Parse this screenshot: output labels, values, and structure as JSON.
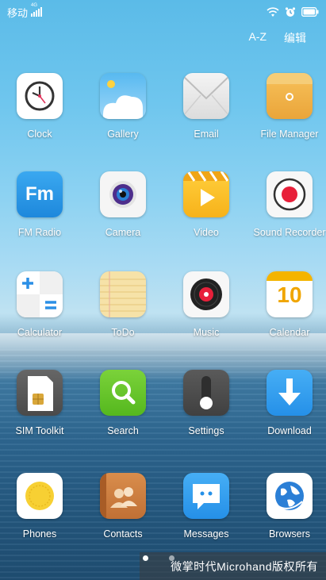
{
  "status_bar": {
    "carrier": "移动",
    "network_tag": "4G"
  },
  "top_actions": {
    "sort": "A-Z",
    "edit": "编辑"
  },
  "apps": [
    {
      "label": "Clock",
      "icon": "clock-icon"
    },
    {
      "label": "Gallery",
      "icon": "gallery-icon"
    },
    {
      "label": "Email",
      "icon": "email-icon"
    },
    {
      "label": "File Manager",
      "icon": "file-manager-icon"
    },
    {
      "label": "FM Radio",
      "icon": "fm-radio-icon",
      "icon_text": "Fm"
    },
    {
      "label": "Camera",
      "icon": "camera-icon"
    },
    {
      "label": "Video",
      "icon": "video-icon"
    },
    {
      "label": "Sound Recorder",
      "icon": "sound-recorder-icon"
    },
    {
      "label": "Calculator",
      "icon": "calculator-icon"
    },
    {
      "label": "ToDo",
      "icon": "todo-icon"
    },
    {
      "label": "Music",
      "icon": "music-icon"
    },
    {
      "label": "Calendar",
      "icon": "calendar-icon",
      "icon_text": "10"
    },
    {
      "label": "SIM Toolkit",
      "icon": "sim-toolkit-icon"
    },
    {
      "label": "Search",
      "icon": "search-icon"
    },
    {
      "label": "Settings",
      "icon": "settings-icon"
    },
    {
      "label": "Download",
      "icon": "download-icon"
    },
    {
      "label": "Phones",
      "icon": "phone-icon"
    },
    {
      "label": "Contacts",
      "icon": "contacts-icon"
    },
    {
      "label": "Messages",
      "icon": "messages-icon"
    },
    {
      "label": "Browsers",
      "icon": "browser-icon"
    }
  ],
  "watermark": "微掌时代Microhand版权所有",
  "page_indicator": {
    "pages": 2,
    "current": 1
  }
}
